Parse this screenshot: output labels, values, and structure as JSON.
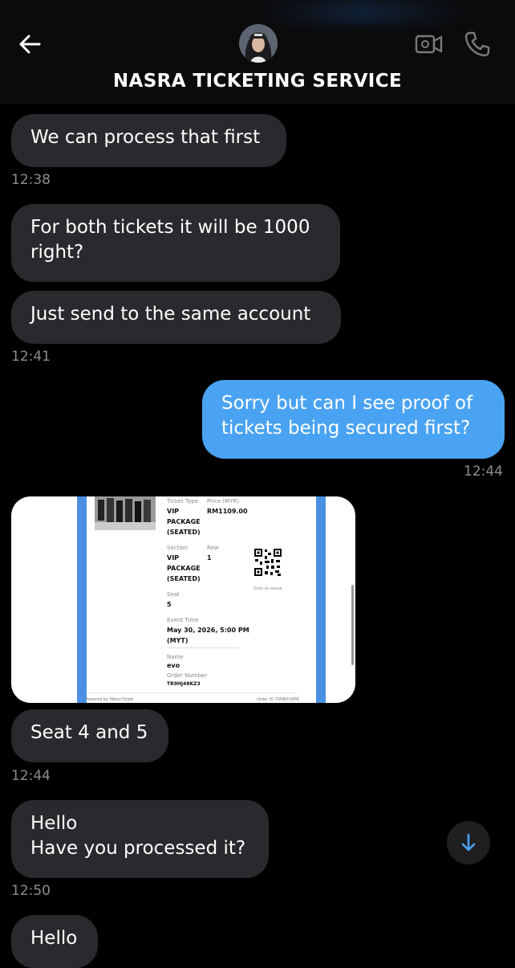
{
  "header": {
    "title": "NASRA TICKETING SERVICE"
  },
  "messages": [
    {
      "text": "We can process that first",
      "time": "12:38"
    },
    {
      "text": "For both tickets it will be 1000\nright?"
    },
    {
      "text": "Just send to the same account",
      "time": "12:41"
    },
    {
      "text": "Sorry but can I see proof of\ntickets being secured first?",
      "time": "12:44"
    },
    {
      "text": "Seat 4 and 5",
      "time": "12:44"
    },
    {
      "text": "Hello\nHave you processed it?",
      "time": "12:50"
    },
    {
      "text": "Hello"
    }
  ],
  "ticket": {
    "ticket_type_label": "Ticket Type",
    "ticket_type_value": "VIP\nPACKAGE\n(SEATED)",
    "price_label": "Price (MYR)",
    "price_value": "RM1109.00",
    "section_label": "Section",
    "section_value": "VIP\nPACKAGE\n(SEATED)",
    "row_label": "Row",
    "row_value": "1",
    "seat_label": "Seat",
    "seat_value": "5",
    "event_time_label": "Event Time",
    "event_time_value": "May 30, 2026, 5:00 PM\n(MYT)",
    "name_label": "Name",
    "name_value": "evo",
    "order_label": "Order Number",
    "order_value": "TR9HJ48KZ3",
    "scan_label": "Scan at venue",
    "footer_left": "Powered by MelonTicket",
    "footer_right": "Order ID 7SNNXV4PK"
  },
  "colors": {
    "incoming": "#2a2a2e",
    "outgoing": "#4aa3f2",
    "ticket_accent": "#4a90e2"
  }
}
